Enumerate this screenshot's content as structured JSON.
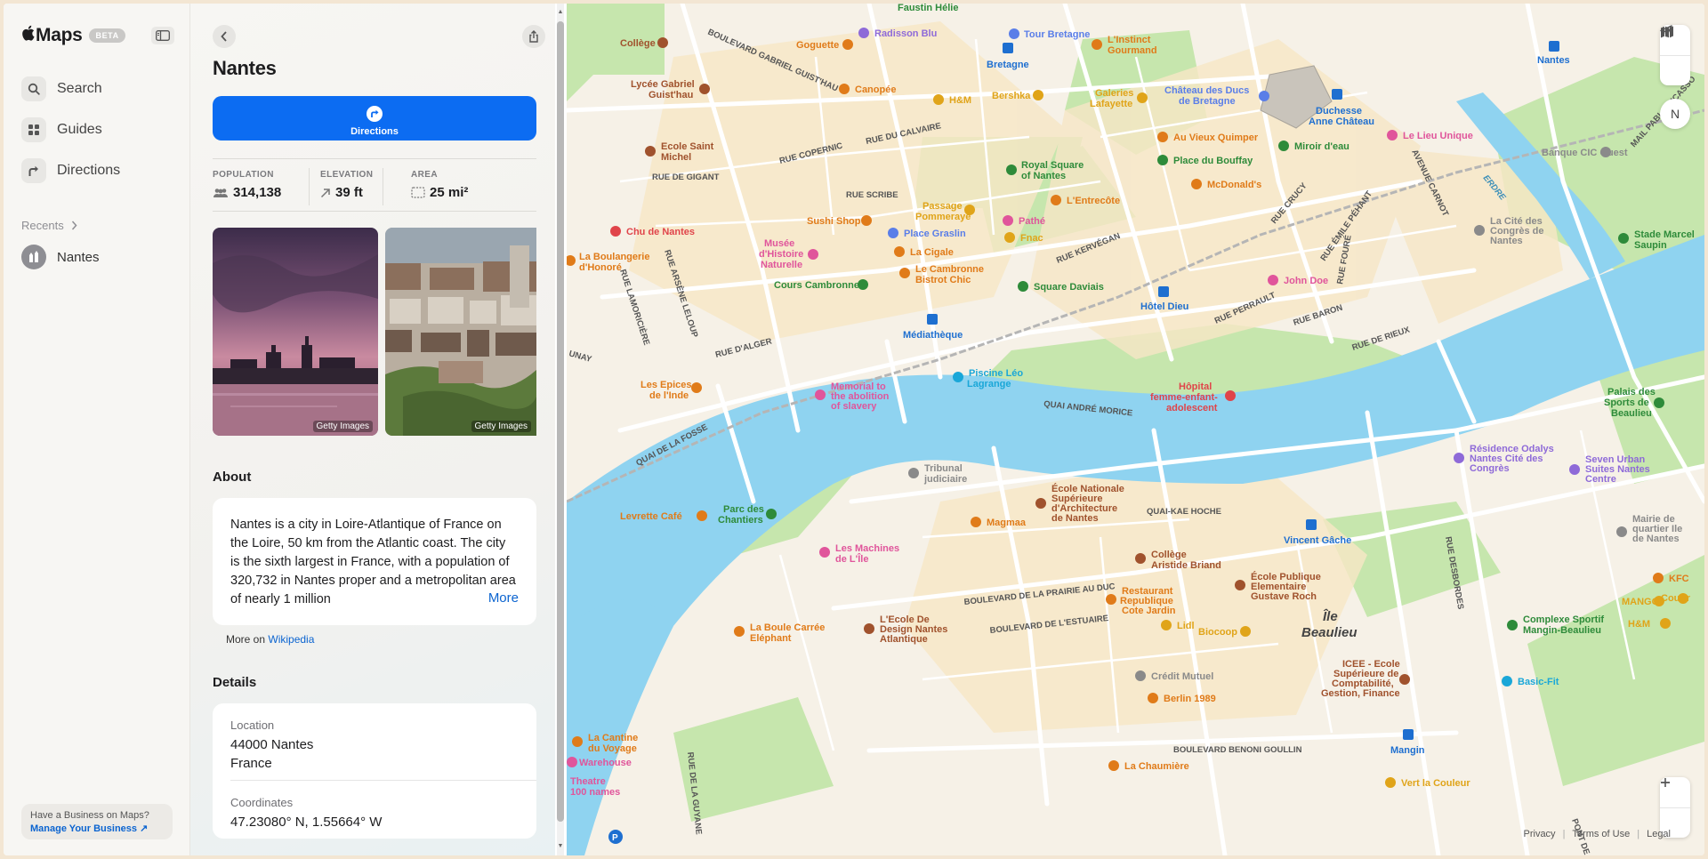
{
  "app": {
    "brand": "Maps",
    "beta": "BETA"
  },
  "nav": {
    "items": [
      {
        "label": "Search",
        "icon": "search-icon"
      },
      {
        "label": "Guides",
        "icon": "guides-icon"
      },
      {
        "label": "Directions",
        "icon": "directions-icon"
      }
    ],
    "recents_label": "Recents",
    "recents": [
      {
        "label": "Nantes",
        "icon": "landmark-icon"
      }
    ]
  },
  "business": {
    "question": "Have a Business on Maps?",
    "link": "Manage Your Business ↗"
  },
  "place": {
    "name": "Nantes",
    "directions_label": "Directions",
    "stats": {
      "population_label": "POPULATION",
      "population": "314,138",
      "elevation_label": "ELEVATION",
      "elevation": "39 ft",
      "area_label": "AREA",
      "area": "25 mi²"
    },
    "photos": [
      {
        "credit": "Getty Images"
      },
      {
        "credit": "Getty Images"
      }
    ],
    "about_heading": "About",
    "about_text": "Nantes is a city in Loire-Atlantique of France on the Loire, 50 km from the Atlantic coast. The city is the sixth largest in France, with a population of 320,732 in Nantes proper and a metropolitan area of nearly 1 million",
    "more_label": "More",
    "wiki_prefix": "More on",
    "wiki_link": "Wikipedia",
    "details_heading": "Details",
    "location_label": "Location",
    "location_line1": "44000 Nantes",
    "location_line2": "France",
    "coordinates_label": "Coordinates",
    "coordinates": "47.23080° N, 1.55664° W"
  },
  "map": {
    "compass": "N",
    "footer": {
      "privacy": "Privacy",
      "terms": "Terms of Use",
      "legal": "Legal"
    },
    "colors": {
      "water": "#8fd3f0",
      "park": "#bfe3a6",
      "land": "#f6f1e7",
      "road": "#ffffff",
      "accent": "#0c6cf2"
    },
    "pois": [
      {
        "label": "Collège",
        "color": "#a0522d"
      },
      {
        "label": "Lycée Gabriel Guist'hau",
        "color": "#a0522d"
      },
      {
        "label": "Ecole Saint Michel",
        "color": "#a0522d"
      },
      {
        "label": "Goguette",
        "color": "#e07b19"
      },
      {
        "label": "Canopée",
        "color": "#e07b19"
      },
      {
        "label": "Radisson Blu",
        "color": "#8e6ad8"
      },
      {
        "label": "Faustin Hélie",
        "color": "#2e8b3a"
      },
      {
        "label": "Tour Bretagne",
        "color": "#5a7ee8"
      },
      {
        "label": "Bretagne",
        "color": "#1e6fd0"
      },
      {
        "label": "L'Instinct Gourmand",
        "color": "#e07b19"
      },
      {
        "label": "Galeries Lafayette",
        "color": "#e0a419"
      },
      {
        "label": "Bershka",
        "color": "#e0a419"
      },
      {
        "label": "H&M",
        "color": "#e0a419"
      },
      {
        "label": "Château des Ducs de Bretagne",
        "color": "#5a7ee8"
      },
      {
        "label": "Duchesse Anne Château",
        "color": "#1e6fd0"
      },
      {
        "label": "Miroir d'eau",
        "color": "#2e8b3a"
      },
      {
        "label": "Nantes",
        "color": "#1e6fd0"
      },
      {
        "label": "Le Lieu Unique",
        "color": "#e0559b"
      },
      {
        "label": "Banque CIC Ouest",
        "color": "#8a8a8a"
      },
      {
        "label": "Au Vieux Quimper",
        "color": "#e07b19"
      },
      {
        "label": "Place du Bouffay",
        "color": "#2e8b3a"
      },
      {
        "label": "McDonald's",
        "color": "#e07b19"
      },
      {
        "label": "Royal Square of Nantes",
        "color": "#2e8b3a"
      },
      {
        "label": "L'Entrecôte",
        "color": "#e07b19"
      },
      {
        "label": "Passage Pommeraye",
        "color": "#e0a419"
      },
      {
        "label": "Pathé",
        "color": "#e0559b"
      },
      {
        "label": "Fnac",
        "color": "#e0a419"
      },
      {
        "label": "Sushi Shop",
        "color": "#e07b19"
      },
      {
        "label": "Place Graslin",
        "color": "#5a7ee8"
      },
      {
        "label": "Chu de Nantes",
        "color": "#e0444a"
      },
      {
        "label": "Musée d'Histoire Naturelle",
        "color": "#e0559b"
      },
      {
        "label": "La Cigale",
        "color": "#e07b19"
      },
      {
        "label": "Le Cambronne Bistrot Chic",
        "color": "#e07b19"
      },
      {
        "label": "Cours Cambronne",
        "color": "#2e8b3a"
      },
      {
        "label": "Square Daviais",
        "color": "#2e8b3a"
      },
      {
        "label": "Hôtel Dieu",
        "color": "#1e6fd0"
      },
      {
        "label": "John Doe",
        "color": "#e0559b"
      },
      {
        "label": "La Boulangerie d'Honoré",
        "color": "#e07b19"
      },
      {
        "label": "Médiathèque",
        "color": "#1e6fd0"
      },
      {
        "label": "Les Epices de l'Inde",
        "color": "#e07b19"
      },
      {
        "label": "Memorial to the abolition of slavery",
        "color": "#e0559b"
      },
      {
        "label": "Piscine Léo Lagrange",
        "color": "#1aa7d8"
      },
      {
        "label": "Hôpital femme-enfant-adolescent",
        "color": "#e0444a"
      },
      {
        "label": "La Cité des Congrès de Nantes",
        "color": "#8a8a8a"
      },
      {
        "label": "Stade Marcel Saupin",
        "color": "#2e8b3a"
      },
      {
        "label": "Palais des Sports de Beaulieu",
        "color": "#2e8b3a"
      },
      {
        "label": "Résidence Odalys Nantes Cité des Congrès",
        "color": "#8e6ad8"
      },
      {
        "label": "Seven Urban Suites Nantes Centre",
        "color": "#8e6ad8"
      },
      {
        "label": "Tribunal judiciaire",
        "color": "#8a8a8a"
      },
      {
        "label": "École Nationale Supérieure d'Architecture de Nantes",
        "color": "#a0522d"
      },
      {
        "label": "Magmaa",
        "color": "#e07b19"
      },
      {
        "label": "Levrette Café",
        "color": "#e07b19"
      },
      {
        "label": "Parc des Chantiers",
        "color": "#2e8b3a"
      },
      {
        "label": "Les Machines de L'Île",
        "color": "#e0559b"
      },
      {
        "label": "Collège Aristide Briand",
        "color": "#a0522d"
      },
      {
        "label": "Vincent Gâche",
        "color": "#1e6fd0"
      },
      {
        "label": "École Publique Elementaire Gustave Roch",
        "color": "#a0522d"
      },
      {
        "label": "Mairie de quartier Ile de Nantes",
        "color": "#8a8a8a"
      },
      {
        "label": "KFC",
        "color": "#e07b19"
      },
      {
        "label": "MANGO",
        "color": "#e0a419"
      },
      {
        "label": "Courir",
        "color": "#e0a419"
      },
      {
        "label": "H&M",
        "color": "#e0a419"
      },
      {
        "label": "Restaurant Republique Cote Jardin",
        "color": "#e07b19"
      },
      {
        "label": "Lidl",
        "color": "#e0a419"
      },
      {
        "label": "Biocoop",
        "color": "#e0a419"
      },
      {
        "label": "Complexe Sportif Mangin-Beaulieu",
        "color": "#2e8b3a"
      },
      {
        "label": "La Boule Carrée Eléphant",
        "color": "#e07b19"
      },
      {
        "label": "L'Ecole De Design Nantes Atlantique",
        "color": "#a0522d"
      },
      {
        "label": "Crédit Mutuel",
        "color": "#8a8a8a"
      },
      {
        "label": "Berlin 1989",
        "color": "#e07b19"
      },
      {
        "label": "ICEE - Ecole Supérieure de Comptabilité, Gestion, Finance",
        "color": "#a0522d"
      },
      {
        "label": "Basic-Fit",
        "color": "#1aa7d8"
      },
      {
        "label": "La Cantine du Voyage",
        "color": "#e07b19"
      },
      {
        "label": "Warehouse",
        "color": "#e0559b"
      },
      {
        "label": "Theatre 100 names",
        "color": "#e0559b"
      },
      {
        "label": "La Chaumière",
        "color": "#e07b19"
      },
      {
        "label": "Mangin",
        "color": "#1e6fd0"
      },
      {
        "label": "Vert la Couleur",
        "color": "#e0a419"
      },
      {
        "label": "Île Beaulieu",
        "color": "#444444"
      }
    ],
    "streets": [
      "BOULEVARD GABRIEL GUIST'HAU",
      "RUE DU CALVAIRE",
      "RUE COPERNIC",
      "RUE DE GIGANT",
      "RUE SCRIBE",
      "RUE KERVÉGAN",
      "RUE D'ALGER",
      "RUE ARSÈNE LELOUP",
      "RUE LAMORICIÈRE",
      "QUAI DE LA FOSSE",
      "QUAI ANDRÉ MORICE",
      "QUAI-KAE HOCHE",
      "BOULEVARD DE LA PRAIRIE AU DUC",
      "BOULEVARD DE L'ESTUAIRE",
      "BOULEVARD BENONI GOULLIN",
      "RUE DE LA GUYANE",
      "RUE DE RIEUX",
      "RUE BARON",
      "RUE PERRAULT",
      "RUE CRUCY",
      "RUE ÉMILE PÉHANT",
      "AVENUE CARNOT",
      "RUE FOURÉ",
      "RUE DESBORDES",
      "MAIL PABLO PICASSO",
      "ERDRE",
      "UNAY",
      "PONT DE"
    ]
  }
}
